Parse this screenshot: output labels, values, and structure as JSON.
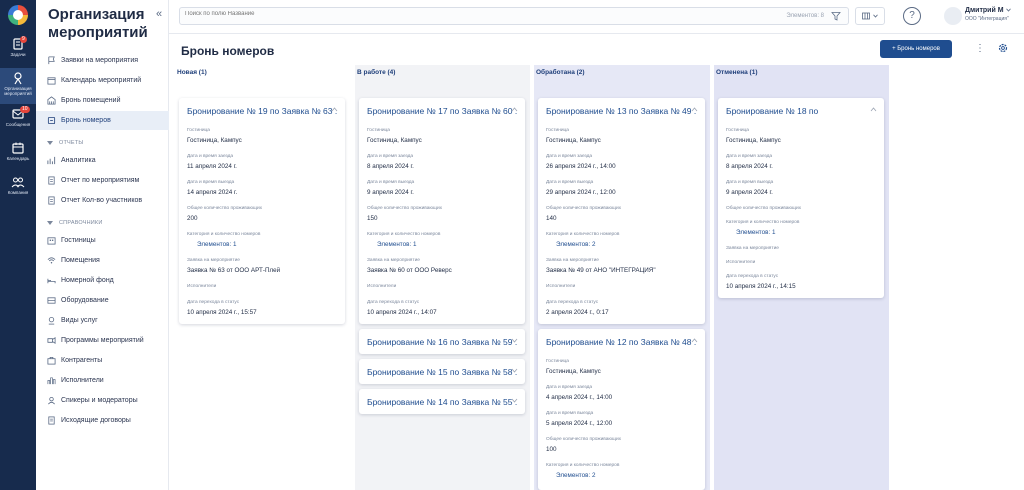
{
  "rail": {
    "items": [
      {
        "label": "Задачи",
        "badge": "9"
      },
      {
        "label": "Организация мероприятий"
      },
      {
        "label": "Сообщения",
        "badge": "10"
      },
      {
        "label": "Календарь"
      },
      {
        "label": "Компания"
      }
    ]
  },
  "nav": {
    "title": "Организация мероприятий",
    "collapse_glyph": "«",
    "items": [
      {
        "label": "Заявки на мероприятия",
        "icon": "flag-icon"
      },
      {
        "label": "Календарь мероприятий",
        "icon": "calendar-icon"
      },
      {
        "label": "Бронь помещений",
        "icon": "building-icon"
      },
      {
        "label": "Бронь номеров",
        "icon": "bed-icon",
        "active": true
      }
    ],
    "section_reports": "ОТЧЕТЫ",
    "reports": [
      {
        "label": "Аналитика",
        "icon": "chart-icon"
      },
      {
        "label": "Отчет по мероприятиям",
        "icon": "report-icon"
      },
      {
        "label": "Отчет Кол-во участников",
        "icon": "report-icon"
      }
    ],
    "section_refs": "СПРАВОЧНИКИ",
    "refs": [
      {
        "label": "Гостиницы",
        "icon": "hotel-icon"
      },
      {
        "label": "Помещения",
        "icon": "wifi-icon"
      },
      {
        "label": "Номерной фонд",
        "icon": "bed-icon"
      },
      {
        "label": "Оборудование",
        "icon": "equipment-icon"
      },
      {
        "label": "Виды услуг",
        "icon": "service-icon"
      },
      {
        "label": "Программы мероприятий",
        "icon": "program-icon"
      },
      {
        "label": "Контрагенты",
        "icon": "contractor-icon"
      },
      {
        "label": "Исполнители",
        "icon": "performers-icon"
      },
      {
        "label": "Спикеры и модераторы",
        "icon": "speaker-icon"
      },
      {
        "label": "Исходящие договоры",
        "icon": "contract-icon"
      }
    ]
  },
  "topbar": {
    "search_placeholder": "Поиск по полю Название",
    "count_text": "Элементов: 8",
    "user_name": "Дмитрий М",
    "user_org": "ООО \"Интеграция\""
  },
  "page": {
    "title": "Бронь номеров",
    "add_label": "+ Бронь номеров"
  },
  "labels": {
    "hotel": "Гостиница",
    "checkin": "Дата и время заезда",
    "checkout": "Дата и время выезда",
    "guests": "Общее количество проживающих",
    "rooms": "Категория и количество номеров",
    "request": "Заявка на мероприятие",
    "performers": "Исполнители",
    "transition": "Дата перехода в статус"
  },
  "columns": [
    {
      "title": "Новая (1)",
      "color": "#ffffff",
      "cards": [
        {
          "title": "Бронирование № 19 по Заявка № 63 ...",
          "hotel": "Гостиница, Кампус",
          "checkin": "11 апреля 2024 г.",
          "checkout": "14 апреля 2024 г.",
          "guests": "200",
          "rooms": "Элементов: 1",
          "request": "Заявка № 63 от ООО АРТ-Плей",
          "transition": "10 апреля 2024 г., 15:57"
        }
      ]
    },
    {
      "title": "В работе (4)",
      "color": "#f2f3f6",
      "cards": [
        {
          "title": "Бронирование № 17 по Заявка № 60 ...",
          "hotel": "Гостиница, Кампус",
          "checkin": "8 апреля 2024 г.",
          "checkout": "9 апреля 2024 г.",
          "guests": "150",
          "rooms": "Элементов: 1",
          "request": "Заявка № 60 от ООО Реверс",
          "transition": "10 апреля 2024 г., 14:07"
        },
        {
          "title": "Бронирование № 16 по Заявка № 59 ..."
        },
        {
          "title": "Бронирование № 15 по Заявка № 58 ..."
        },
        {
          "title": "Бронирование № 14 по Заявка № 55 ..."
        }
      ]
    },
    {
      "title": "Обработана (2)",
      "color": "#e6e8f6",
      "cards": [
        {
          "title": "Бронирование № 13 по Заявка № 49 ...",
          "hotel": "Гостиница, Кампус",
          "checkin": "26 апреля 2024 г., 14:00",
          "checkout": "29 апреля 2024 г., 12:00",
          "guests": "140",
          "rooms": "Элементов: 2",
          "request": "Заявка № 49 от АНО \"ИНТЕГРАЦИЯ\"",
          "transition": "2 апреля 2024 г., 0:17"
        },
        {
          "title": "Бронирование № 12 по Заявка № 48 ...",
          "hotel": "Гостиница, Кампус",
          "checkin": "4 апреля 2024 г., 14:00",
          "checkout": "5 апреля 2024 г., 12:00",
          "guests": "100",
          "rooms": "Элементов: 2"
        }
      ]
    },
    {
      "title": "Отменена (1)",
      "color": "#e1e3f4",
      "cards": [
        {
          "title": "Бронирование № 18 по",
          "hotel": "Гостиница, Кампус",
          "checkin": "8 апреля 2024 г.",
          "checkout": "9 апреля 2024 г.",
          "rooms": "Элементов: 1",
          "transition": "10 апреля 2024 г., 14:15"
        }
      ]
    }
  ]
}
